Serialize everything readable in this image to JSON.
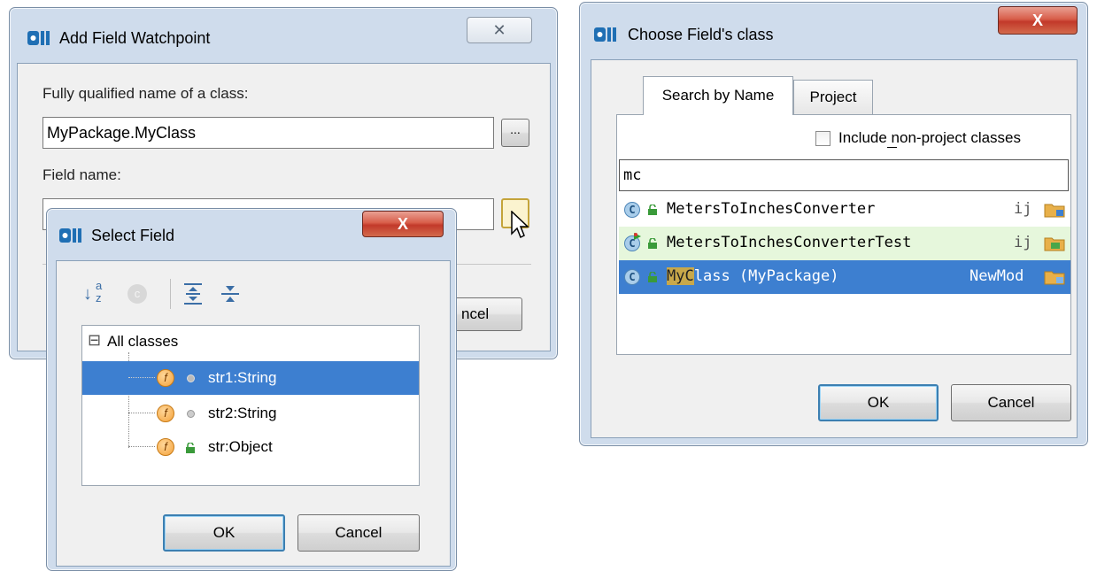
{
  "add_watch": {
    "title": "Add Field Watchpoint",
    "close": "✕",
    "class_label": "Fully qualified name of a class:",
    "class_value": "MyPackage.MyClass",
    "browse_label": "...",
    "field_label": "Field name:",
    "cancel_fragment": "ncel"
  },
  "select_field": {
    "title": "Select Field",
    "close": "X",
    "toolbar": {
      "sort_glyph": "↓",
      "sort_a": "a",
      "sort_z": "z",
      "circle_glyph": "c"
    },
    "tree": {
      "expander": "⊟",
      "root": "All classes",
      "items": [
        {
          "name": "str1:String"
        },
        {
          "name": "str2:String"
        },
        {
          "name": "str:Object"
        }
      ]
    },
    "field_icon": "f",
    "ok": "OK",
    "cancel": "Cancel"
  },
  "choose_class": {
    "title": "Choose Field's class",
    "close": "X",
    "tabs": [
      "Search by Name",
      "Project"
    ],
    "include_label": "Include non-project classes",
    "search_value": "mc",
    "class_icon": "C",
    "results": [
      {
        "name": "MetersToInchesConverter",
        "module": "ij"
      },
      {
        "name": "MetersToInchesConverterTest",
        "module": "ij"
      },
      {
        "name_pre": "My",
        "name_mid": "C",
        "name_post": "lass (MyPackage)",
        "module": "NewMod"
      }
    ],
    "ok": "OK",
    "cancel": "Cancel"
  },
  "colors": {
    "selection": "#3d7fd0",
    "test_row": "#e6f7dc",
    "default_button_border": "#3c7fb1"
  }
}
